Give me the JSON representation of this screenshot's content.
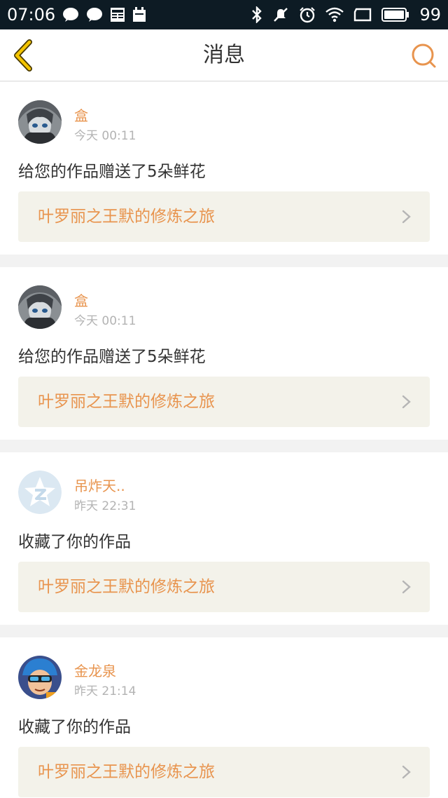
{
  "status_bar": {
    "time": "07:06",
    "battery": "99",
    "icons_left": [
      "message-icon",
      "message-icon",
      "news-icon",
      "calendar-icon"
    ],
    "icons_right": [
      "bluetooth-icon",
      "mute-icon",
      "alarm-icon",
      "wifi-icon",
      "screen-icon",
      "battery-icon"
    ]
  },
  "nav": {
    "title": "消息",
    "back_icon": "chevron-left-icon",
    "search_icon": "search-icon"
  },
  "colors": {
    "accent": "#e8944e",
    "back_arrow": "#f4c400",
    "status_bar_bg": "#0d1b24",
    "card_link_bg": "#f3f2ea"
  },
  "messages": [
    {
      "name": "盒",
      "time": "今天 00:11",
      "action": "给您的作品赠送了5朵鲜花",
      "work_title": "叶罗丽之王默的修炼之旅",
      "avatar": "anime-girl-avatar"
    },
    {
      "name": "盒",
      "time": "今天 00:11",
      "action": "给您的作品赠送了5朵鲜花",
      "work_title": "叶罗丽之王默的修炼之旅",
      "avatar": "anime-girl-avatar"
    },
    {
      "name": "吊炸天..",
      "time": "昨天 22:31",
      "action": "收藏了你的作品",
      "work_title": "叶罗丽之王默的修炼之旅",
      "avatar": "default-star-avatar"
    },
    {
      "name": "金龙泉",
      "time": "昨天 21:14",
      "action": "收藏了你的作品",
      "work_title": "叶罗丽之王默的修炼之旅",
      "avatar": "cartoon-boy-avatar"
    }
  ]
}
